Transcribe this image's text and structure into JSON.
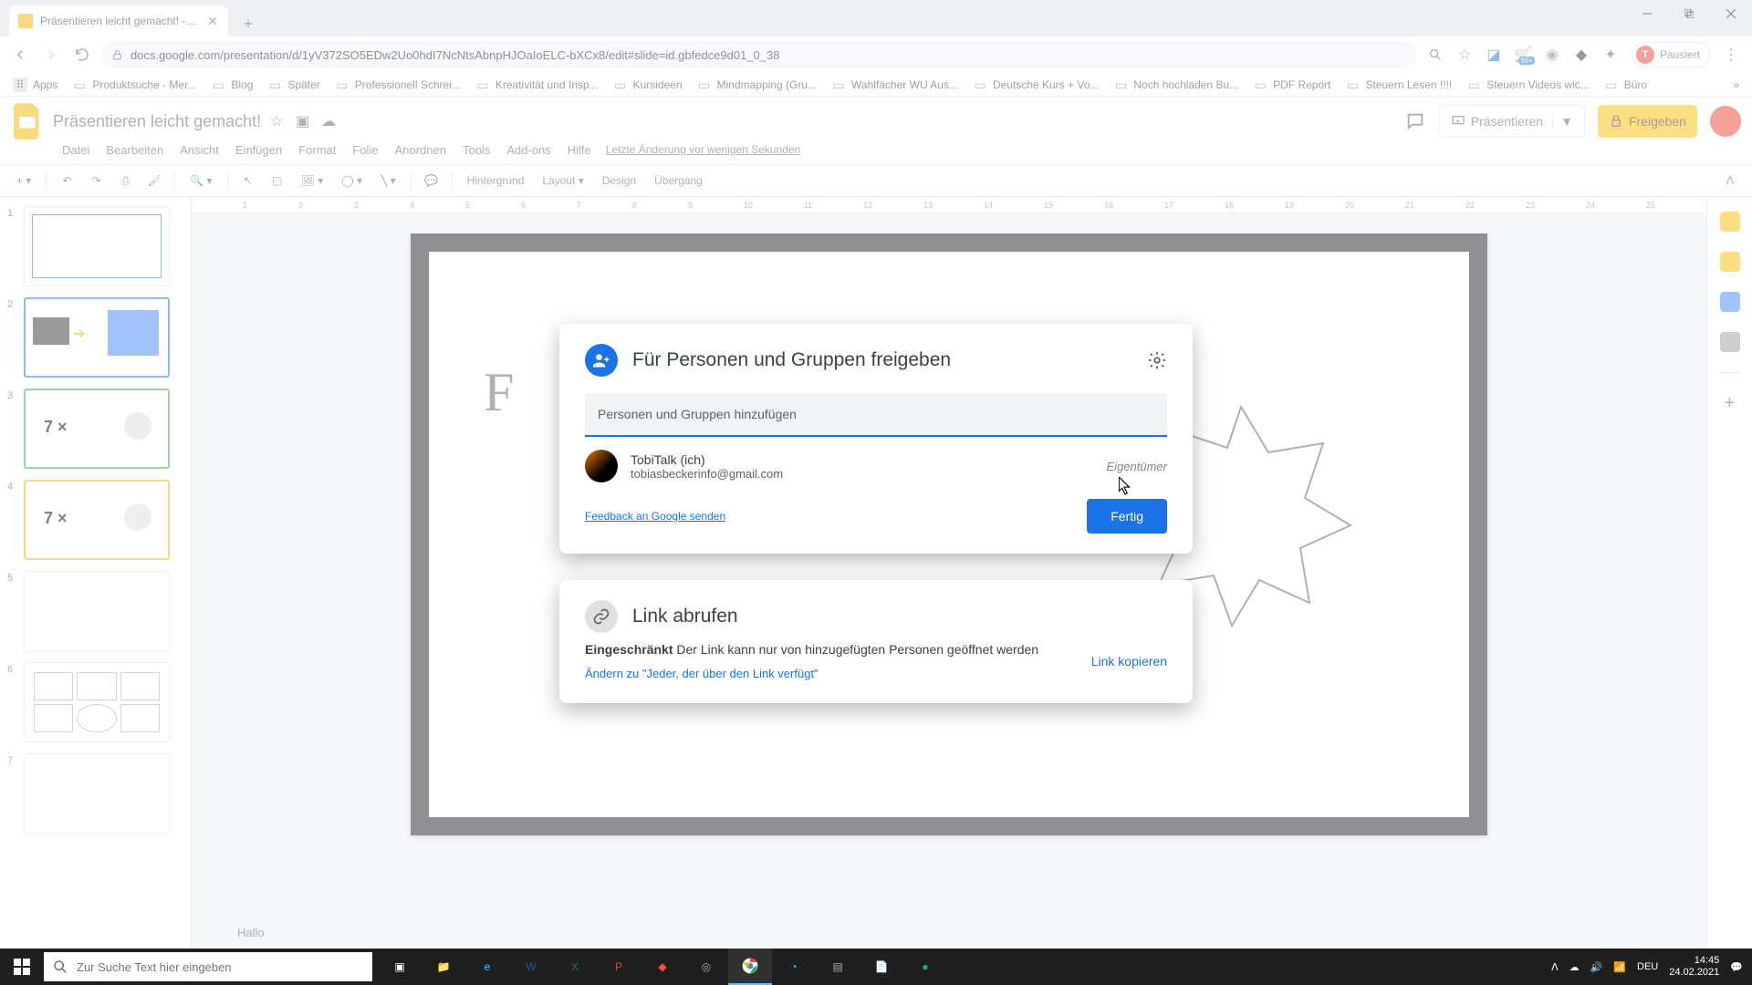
{
  "browser": {
    "tab_title": "Präsentieren leicht gemacht! - G…",
    "url": "docs.google.com/presentation/d/1yV372SO5EDw2Uo0hdI7NcNtsAbnpHJOaIoELC-bXCx8/edit#slide=id.gbfedce9d01_0_38",
    "pause_label": "Pausiert",
    "avatar_initial": "T",
    "ext_badge": "99+",
    "bookmarks": [
      "Apps",
      "Produktsuche - Mer...",
      "Blog",
      "Später",
      "Professionell Schrei...",
      "Kreativität und Insp...",
      "Kursideen",
      "Mindmapping  (Gru...",
      "Wahlfächer WU Aus...",
      "Deutsche Kurs + Vo...",
      "Noch hochladen Bu...",
      "PDF Report",
      "Steuern Lesen !!!!",
      "Steuern Videos wic...",
      "Büro"
    ]
  },
  "app": {
    "doc_title": "Präsentieren leicht gemacht!",
    "menu": [
      "Datei",
      "Bearbeiten",
      "Ansicht",
      "Einfügen",
      "Format",
      "Folie",
      "Anordnen",
      "Tools",
      "Add-ons",
      "Hilfe"
    ],
    "last_edit": "Letzte Änderung vor wenigen Sekunden",
    "present": "Präsentieren",
    "share": "Freigeben",
    "toolbar_text": [
      "Hintergrund",
      "Layout ▾",
      "Design",
      "Übergang"
    ],
    "speaker_notes": "Hallo"
  },
  "ruler": [
    "1",
    "2",
    "3",
    "4",
    "5",
    "6",
    "7",
    "8",
    "9",
    "10",
    "11",
    "12",
    "13",
    "14",
    "15",
    "16",
    "17",
    "18",
    "19",
    "20",
    "21",
    "22",
    "23",
    "24",
    "25"
  ],
  "thumbs": [
    "1",
    "2",
    "3",
    "4",
    "5",
    "6",
    "7"
  ],
  "share_dialog": {
    "title": "Für Personen und Gruppen freigeben",
    "placeholder": "Personen und Gruppen hinzufügen",
    "person": {
      "name": "TobiTalk (ich)",
      "email": "tobiasbeckerinfo@gmail.com",
      "role": "Eigentümer"
    },
    "feedback": "Feedback an Google senden",
    "done": "Fertig"
  },
  "link_dialog": {
    "title": "Link abrufen",
    "restricted_label": "Eingeschränkt",
    "restricted_desc": "Der Link kann nur von hinzugefügten Personen geöffnet werden",
    "change": "Ändern zu \"Jeder, der über den Link verfügt\"",
    "copy": "Link kopieren"
  },
  "taskbar": {
    "search_placeholder": "Zur Suche Text hier eingeben",
    "lang": "DEU",
    "time": "14:45",
    "date": "24.02.2021"
  },
  "thumb_text_7x": "7 ×"
}
